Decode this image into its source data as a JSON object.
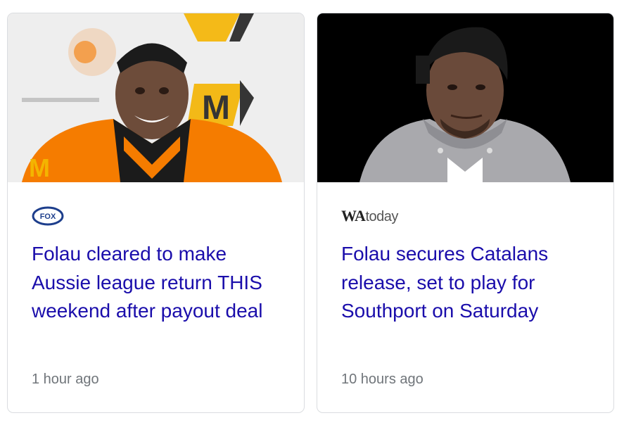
{
  "cards": [
    {
      "source": "FOX",
      "source_icon": "fox-sports-logo",
      "title": "Folau cleared to make Aussie league return THIS weekend after payout deal",
      "time": "1 hour ago"
    },
    {
      "source_part1": "WA",
      "source_part2": "today",
      "source_icon": "watoday-logo",
      "title": "Folau secures Catalans release, set to play for Southport on Saturday",
      "time": "10 hours ago"
    }
  ],
  "colors": {
    "title_link": "#1a0dab",
    "time_text": "#70757a",
    "card_border": "#dadce0"
  }
}
